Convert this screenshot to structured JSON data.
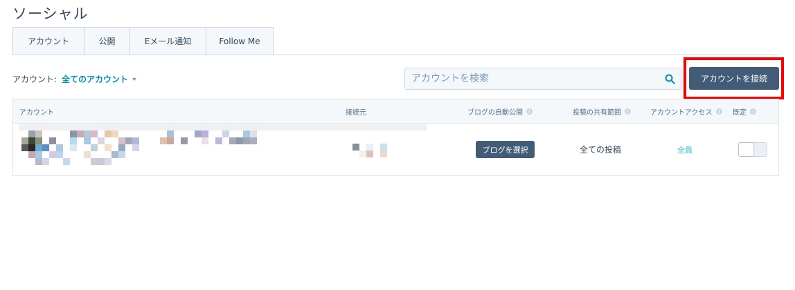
{
  "page": {
    "title": "ソーシャル"
  },
  "tabs": [
    {
      "label": "アカウント"
    },
    {
      "label": "公開"
    },
    {
      "label": "Eメール通知"
    },
    {
      "label": "Follow Me"
    }
  ],
  "filter": {
    "label": "アカウント:",
    "value": "全てのアカウント"
  },
  "search": {
    "placeholder": "アカウントを検索"
  },
  "toolbar": {
    "connect_label": "アカウントを接続"
  },
  "table": {
    "columns": [
      {
        "label": "アカウント",
        "info": false
      },
      {
        "label": "接続元",
        "info": false
      },
      {
        "label": "ブログの自動公開",
        "info": true
      },
      {
        "label": "投稿の共有範囲",
        "info": true
      },
      {
        "label": "アカウントアクセス",
        "info": true
      },
      {
        "label": "既定",
        "info": true
      }
    ],
    "rows": [
      {
        "blog_button": "ブログを選択",
        "share_scope": "全ての投稿",
        "access": "全員",
        "default_enabled": false
      }
    ]
  },
  "colors": {
    "primary_button": "#425b76",
    "link": "#0091ae",
    "highlight": "#ff0000",
    "access_text": "#7fd1de"
  }
}
